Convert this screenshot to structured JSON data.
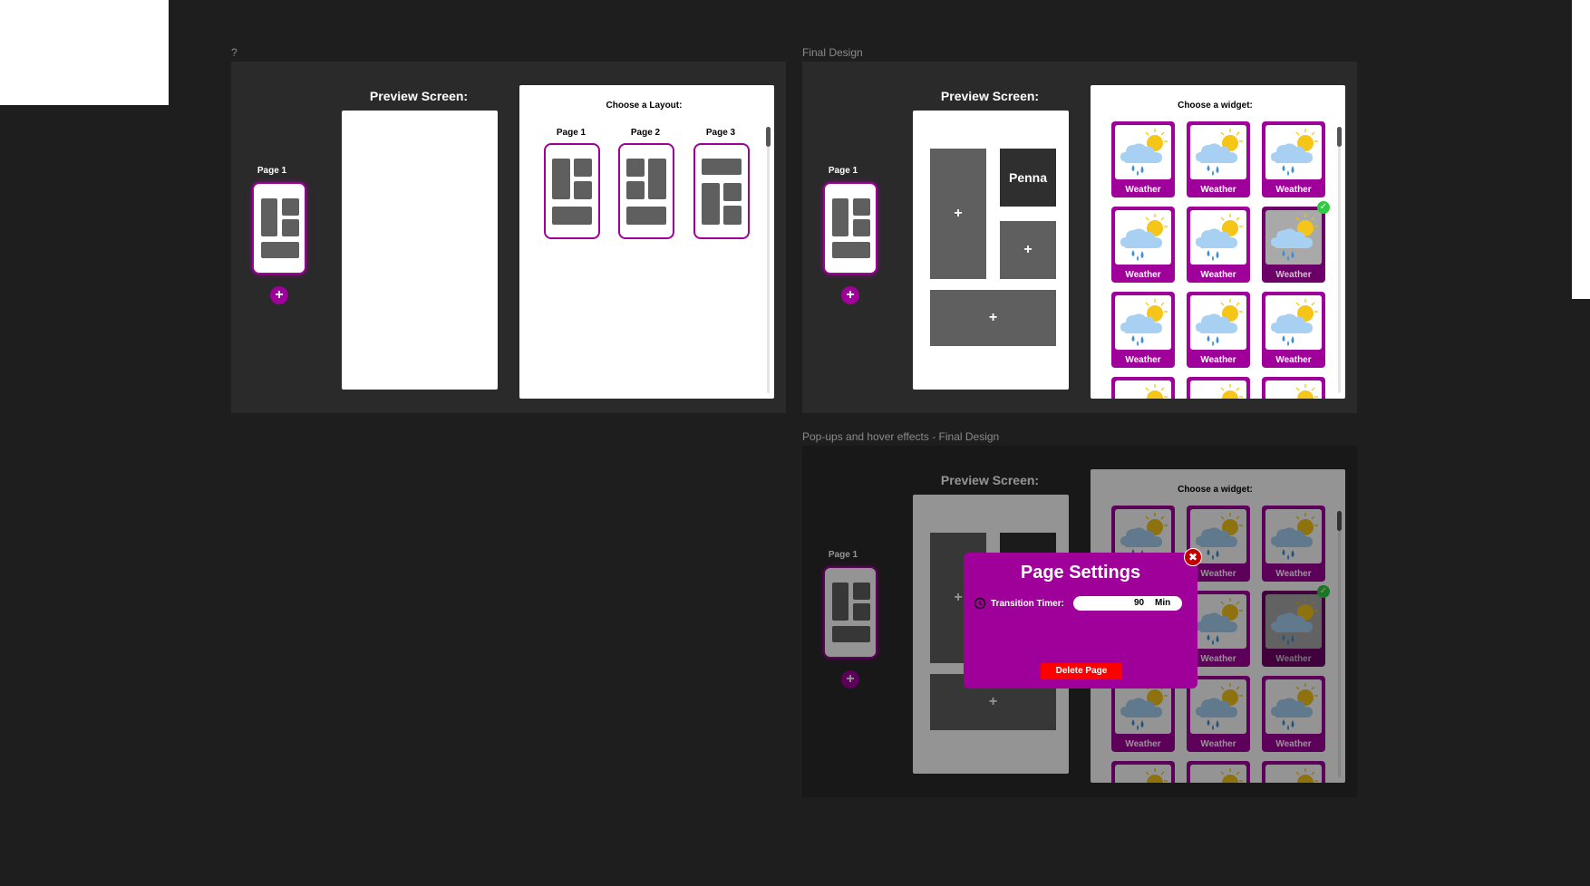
{
  "frames": {
    "left": {
      "label": "?"
    },
    "top_right": {
      "label": "Final Design"
    },
    "bottom_right": {
      "label": "Pop-ups and hover effects - Final Design"
    }
  },
  "sidebar": {
    "page_label": "Page 1"
  },
  "preview": {
    "title": "Preview Screen:"
  },
  "layout_panel": {
    "title": "Choose a Layout:",
    "layouts": [
      {
        "label": "Page 1"
      },
      {
        "label": "Page 2"
      },
      {
        "label": "Page 3"
      }
    ]
  },
  "widget_panel": {
    "title": "Choose a widget:",
    "widget_label": "Weather",
    "selected_index": 5
  },
  "preview_slots": {
    "named_slot": "Penna",
    "add_symbol": "+"
  },
  "modal": {
    "title": "Page Settings",
    "timer_label": "Transition Timer:",
    "timer_value": "90",
    "timer_unit": "Min",
    "delete_label": "Delete Page",
    "close_symbol": "✖"
  },
  "colors": {
    "background": "#1e1e1e",
    "frame": "#2a2a2a",
    "accent": "#a0009a",
    "block_gray": "#5f5f5f",
    "delete_red": "#ff0000",
    "check_green": "#2ecc40"
  },
  "icons": {
    "weather": "cloud-rain-sun-icon",
    "add": "plus-icon",
    "check": "check-icon",
    "timer": "clock-icon",
    "close": "close-icon"
  }
}
